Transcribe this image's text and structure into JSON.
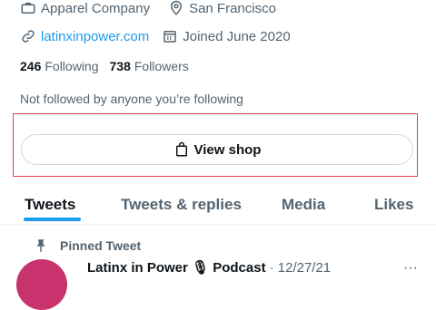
{
  "profile": {
    "category": "Apparel Company",
    "location": "San Francisco",
    "website": "latinxinpower.com",
    "joined": "Joined June 2020",
    "following_count": "246",
    "following_label": "Following",
    "followers_count": "738",
    "followers_label": "Followers",
    "mutual_followers": "Not followed by anyone you’re following"
  },
  "shop": {
    "button_label": "View shop"
  },
  "tabs": [
    {
      "label": "Tweets",
      "active": true
    },
    {
      "label": "Tweets & replies",
      "active": false
    },
    {
      "label": "Media",
      "active": false
    },
    {
      "label": "Likes",
      "active": false
    }
  ],
  "pinned_tweet": {
    "pinned_label": "Pinned Tweet",
    "author": "Latinx in Power 🎙 Podcast",
    "date": "· 12/27/21",
    "more": "···"
  },
  "colors": {
    "accent": "#1d9bf0",
    "highlight_border": "#e0413f",
    "secondary_text": "#536471",
    "avatar": "#c8326d"
  }
}
